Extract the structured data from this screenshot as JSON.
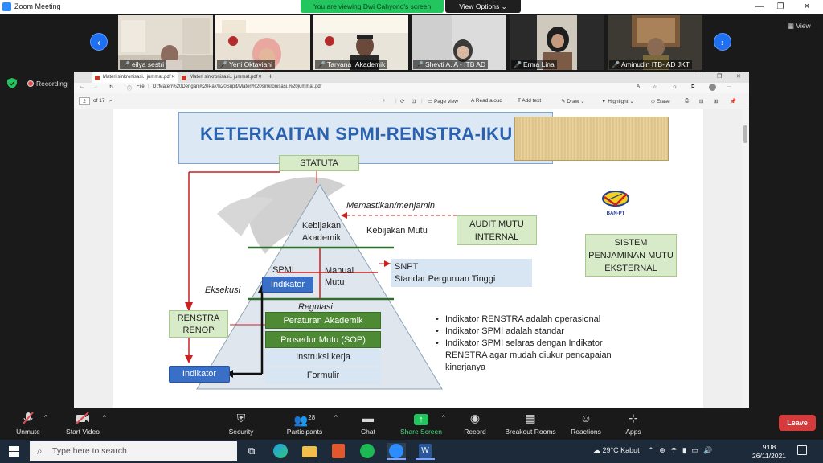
{
  "app": {
    "title": "Zoom Meeting",
    "banner": "You are viewing Dwi Cahyono's screen",
    "view_options": "View Options",
    "view_label": "View",
    "recording": "Recording"
  },
  "participants": [
    {
      "name": "eilya sestri"
    },
    {
      "name": "Yeni Oktaviani"
    },
    {
      "name": "Taryana_Akademik"
    },
    {
      "name": "Shevti A. A - ITB AD"
    },
    {
      "name": "Erma Lina"
    },
    {
      "name": "Aminudin ITB- AD JKT"
    }
  ],
  "browser": {
    "tabs": [
      {
        "label": "Materi sinkronisasi.. jummat.pdf"
      },
      {
        "label": "Materi sinkronisasi.. jummat.pdf"
      }
    ],
    "url_label": "File",
    "url": "D:/Materi%20Dengan%20Pak%20Supit/Materi%20sinkronisasi.%20jummat.pdf",
    "page_num": "2",
    "page_total": "of 17",
    "toolbar": {
      "page_view": "Page view",
      "read_aloud": "Read aloud",
      "add_text": "Add text",
      "draw": "Draw",
      "highlight": "Highlight",
      "erase": "Erase"
    }
  },
  "slide": {
    "title": "KETERKAITAN SPMI-RENSTRA-IKU",
    "statuta": "STATUTA",
    "memastikan": "Memastikan/menjamin",
    "kebijakan_akademik": "Kebijakan Akademik",
    "kebijakan_mutu": "Kebijakan Mutu",
    "audit": "AUDIT MUTU INTERNAL",
    "banpt": "BAN-PT",
    "sistem": "SISTEM PENJAMINAN MUTU EKSTERNAL",
    "spmi": "SPMI",
    "manual_mutu": "Manual Mutu",
    "indikator_spmi": "Indikator",
    "snpt_1": "SNPT",
    "snpt_2": "Standar Perguruan Tinggi",
    "eksekusi": "Eksekusi",
    "regulasi": "Regulasi",
    "renstra": "RENSTRA RENOP",
    "peraturan": "Peraturan Akademik",
    "prosedur": "Prosedur Mutu (SOP)",
    "instruksi": "Instruksi kerja",
    "formulir": "Formulir",
    "indikator_bottom": "Indikator",
    "bullets": [
      "Indikator RENSTRA adalah operasional",
      "Indikator SPMI adalah standar",
      "Indikator SPMI selaras dengan Indikator RENSTRA agar mudah diukur pencapaian kinerjanya"
    ]
  },
  "controls": {
    "unmute": "Unmute",
    "start_video": "Start Video",
    "security": "Security",
    "participants": "Participants",
    "participants_count": "28",
    "chat": "Chat",
    "share_screen": "Share Screen",
    "record": "Record",
    "breakout_rooms": "Breakout Rooms",
    "reactions": "Reactions",
    "apps": "Apps",
    "leave": "Leave"
  },
  "taskbar": {
    "search_placeholder": "Type here to search",
    "weather": "29°C  Kabut",
    "time": "9:08",
    "date": "26/11/2021"
  },
  "colors": {
    "zoom_blue": "#2d8cff",
    "banner_green": "#22c55e",
    "leave_red": "#d53b3b",
    "slide_title_blue": "#2a62b0",
    "box_green": "#d8ebc8",
    "dark_green": "#4e8a34",
    "indikator_blue": "#3a6fc7"
  }
}
